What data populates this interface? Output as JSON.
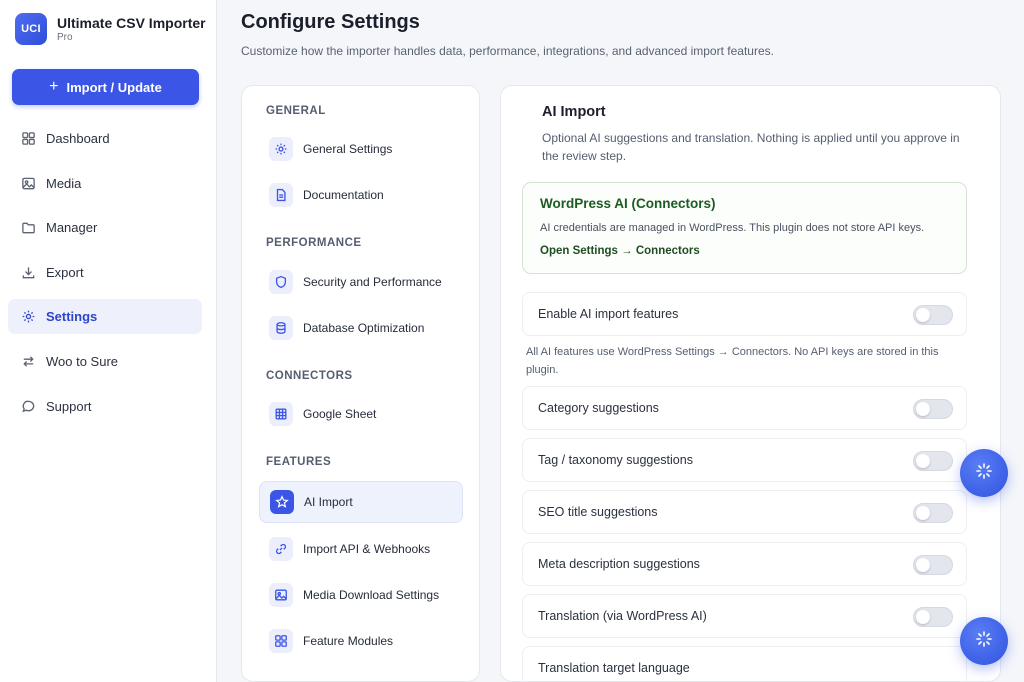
{
  "brand": {
    "logo": "UCI",
    "name": "Ultimate CSV Importer",
    "edition": "Pro"
  },
  "sidebar": {
    "import_label": "Import / Update",
    "items": [
      {
        "label": "Dashboard",
        "icon": "grid-icon"
      },
      {
        "label": "Media",
        "icon": "image-icon"
      },
      {
        "label": "Manager",
        "icon": "folder-icon"
      },
      {
        "label": "Export",
        "icon": "download-icon"
      },
      {
        "label": "Settings",
        "icon": "gear-icon",
        "active": true
      },
      {
        "label": "Woo to Sure",
        "icon": "swap-icon"
      },
      {
        "label": "Support",
        "icon": "chat-icon"
      }
    ]
  },
  "header": {
    "title": "Configure Settings",
    "subtitle": "Customize how the importer handles data, performance, integrations, and advanced import features."
  },
  "settings_nav": {
    "sections": [
      {
        "label": "GENERAL",
        "items": [
          {
            "label": "General Settings",
            "icon": "gear-icon"
          },
          {
            "label": "Documentation",
            "icon": "document-icon"
          }
        ]
      },
      {
        "label": "PERFORMANCE",
        "items": [
          {
            "label": "Security and Performance",
            "icon": "shield-icon"
          },
          {
            "label": "Database Optimization",
            "icon": "database-icon"
          }
        ]
      },
      {
        "label": "CONNECTORS",
        "items": [
          {
            "label": "Google Sheet",
            "icon": "table-icon"
          }
        ]
      },
      {
        "label": "FEATURES",
        "items": [
          {
            "label": "AI Import",
            "icon": "star-icon",
            "active": true
          },
          {
            "label": "Import API & Webhooks",
            "icon": "link-icon"
          },
          {
            "label": "Media Download Settings",
            "icon": "image-icon"
          },
          {
            "label": "Feature Modules",
            "icon": "grid-icon"
          }
        ]
      }
    ]
  },
  "content": {
    "title": "AI Import",
    "description": "Optional AI suggestions and translation. Nothing is applied until you approve in the review step.",
    "wp_box": {
      "title": "WordPress AI (Connectors)",
      "text": "AI credentials are managed in WordPress. This plugin does not store API keys.",
      "link": "Open Settings → Connectors"
    },
    "enable_label": "Enable AI import features",
    "note": "All AI features use WordPress Settings → Connectors. No API keys are stored in this plugin.",
    "toggles": [
      "Category suggestions",
      "Tag / taxonomy suggestions",
      "SEO title suggestions",
      "Meta description suggestions",
      "Translation (via WordPress AI)",
      "Translation target language"
    ]
  },
  "colors": {
    "accent": "#3b55e6",
    "wp_green": "#1d5b22"
  }
}
